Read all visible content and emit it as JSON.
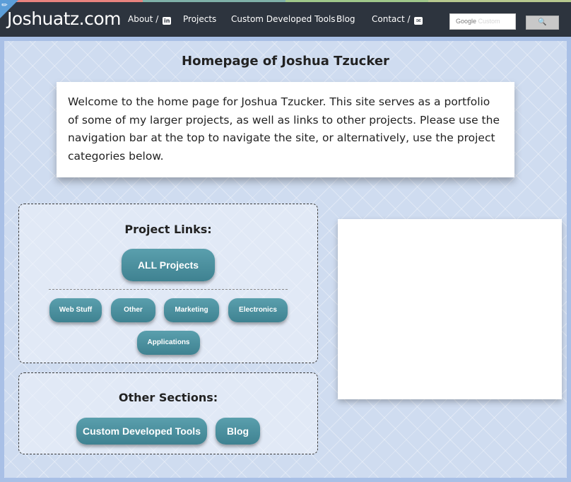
{
  "nav": {
    "brand": "Joshuatz.com",
    "items": [
      {
        "label": "About /",
        "icon": "linkedin-icon",
        "icon_glyph": "in"
      },
      {
        "label": "Projects"
      },
      {
        "label": "Custom Developed Tools"
      },
      {
        "label": "Blog"
      },
      {
        "label": "Contact /",
        "icon": "mail-icon",
        "icon_glyph": "✉"
      }
    ],
    "search": {
      "brand_text": "Google",
      "placeholder": "Custom",
      "button_glyph": "🔍"
    }
  },
  "main": {
    "title": "Homepage of Joshua Tzucker",
    "intro": "Welcome to the home page for Joshua Tzucker. This site serves as a portfolio of some of my larger projects, as well as links to other projects. Please use the navigation bar at the top to navigate the site, or alternatively, use the project categories below.",
    "project_links": {
      "title": "Project Links:",
      "all_button": "ALL Projects",
      "categories": [
        "Web Stuff",
        "Other",
        "Marketing",
        "Electronics",
        "Applications"
      ]
    },
    "other_sections": {
      "title": "Other Sections:",
      "buttons": [
        "Custom Developed Tools",
        "Blog"
      ]
    }
  },
  "colors": {
    "navbar": "#2d343e",
    "button": "#4a8d9c",
    "page_bg": "#a9c0e6"
  }
}
